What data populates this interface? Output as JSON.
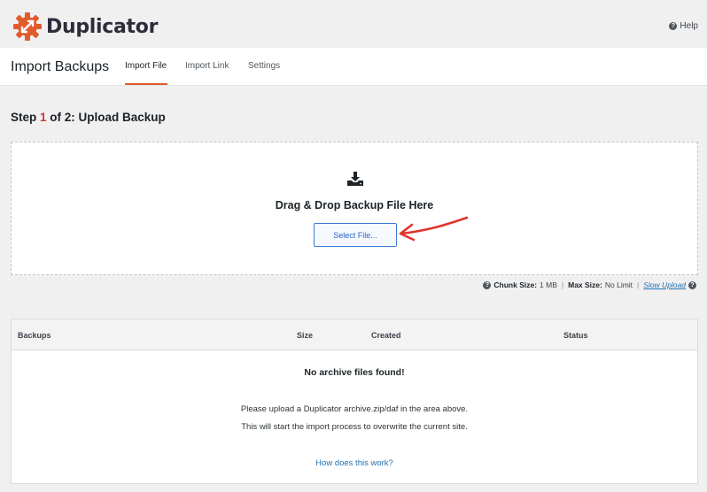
{
  "header": {
    "brand": "Duplicator",
    "help_label": "Help",
    "help_icon": "question-circle-icon"
  },
  "nav": {
    "title": "Import Backups",
    "tabs": [
      {
        "label": "Import File",
        "active": true
      },
      {
        "label": "Import Link",
        "active": false
      },
      {
        "label": "Settings",
        "active": false
      }
    ]
  },
  "step": {
    "prefix": "Step ",
    "number": "1",
    "suffix": " of 2: Upload Backup"
  },
  "dropzone": {
    "icon": "download-icon",
    "title": "Drag & Drop Backup File Here",
    "button_label": "Select File..."
  },
  "chunk_info": {
    "chunk_label": "Chunk Size:",
    "chunk_value": "1 MB",
    "max_label": "Max Size:",
    "max_value": "No Limit",
    "separator": "|",
    "slow_upload_label": "Slow Upload"
  },
  "table": {
    "columns": [
      "Backups",
      "Size",
      "Created",
      "Status"
    ],
    "empty_title": "No archive files found!",
    "empty_line1": "Please upload a Duplicator archive.zip/daf in the area above.",
    "empty_line2": "This will start the import process to overwrite the current site.",
    "how_link": "How does this work?"
  },
  "colors": {
    "brand_orange": "#e15b2c",
    "link_blue": "#2271b1",
    "step_red": "#d63638",
    "annotation_red": "#e0352b"
  }
}
